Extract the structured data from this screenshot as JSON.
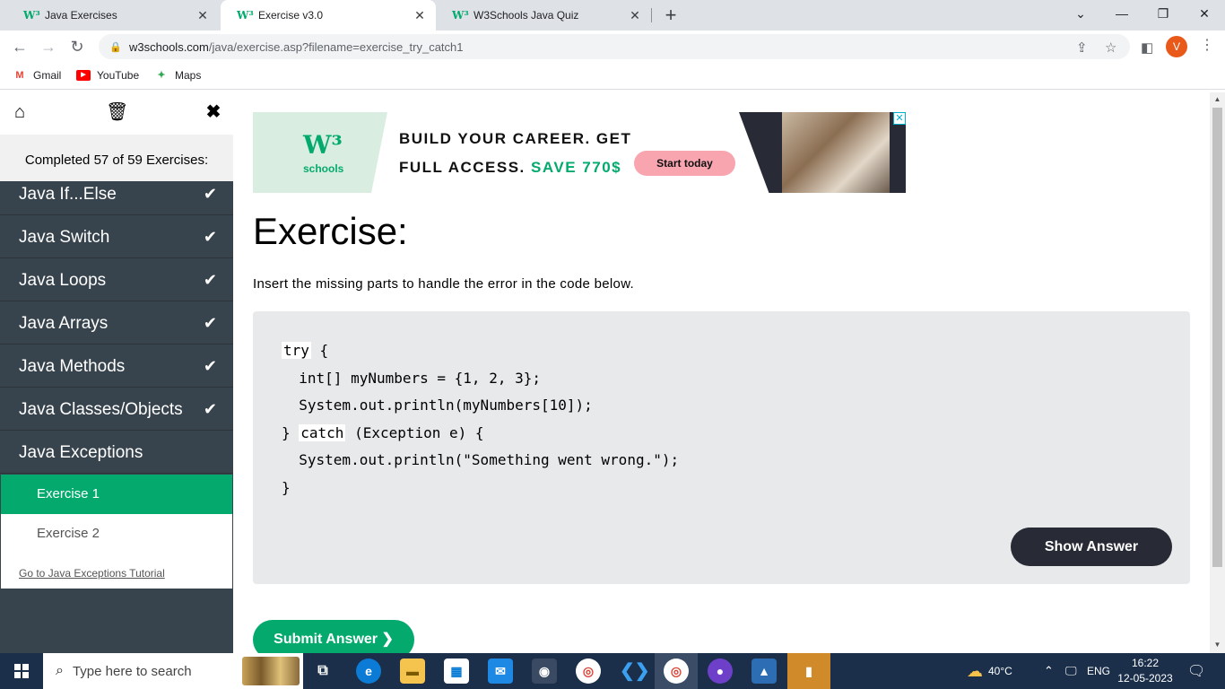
{
  "browser": {
    "tabs": [
      {
        "title": "Java Exercises",
        "favicon": "W³",
        "active": false
      },
      {
        "title": "Exercise v3.0",
        "favicon": "W³",
        "active": true
      },
      {
        "title": "W3Schools Java Quiz",
        "favicon": "W³",
        "active": false
      }
    ],
    "new_tab": "+",
    "window_controls": {
      "dropdown": "⌄",
      "minimize": "—",
      "restore": "❐",
      "close": "✕"
    },
    "url_host": "w3schools.com",
    "url_path": "/java/exercise.asp?filename=exercise_try_catch1",
    "profile_initial": "V",
    "bookmarks": [
      {
        "label": "Gmail",
        "icon": "gmail-icon"
      },
      {
        "label": "YouTube",
        "icon": "youtube-icon"
      },
      {
        "label": "Maps",
        "icon": "maps-icon"
      }
    ]
  },
  "sidebar": {
    "completed_text": "Completed 57 of 59 Exercises:",
    "items": [
      {
        "label": "Java If...Else",
        "done": true
      },
      {
        "label": "Java Switch",
        "done": true
      },
      {
        "label": "Java Loops",
        "done": true
      },
      {
        "label": "Java Arrays",
        "done": true
      },
      {
        "label": "Java Methods",
        "done": true
      },
      {
        "label": "Java Classes/Objects",
        "done": true
      },
      {
        "label": "Java Exceptions",
        "done": false
      }
    ],
    "exercises": [
      "Exercise 1",
      "Exercise 2"
    ],
    "tutorial_link": "Go to Java Exceptions Tutorial"
  },
  "ad": {
    "logo_mark": "W³",
    "logo_text": "schools",
    "line1": "BUILD YOUR CAREER. GET",
    "line2_a": "FULL ACCESS.",
    "line2_b": "SAVE 770$",
    "button": "Start today",
    "close": "✕"
  },
  "exercise": {
    "title": "Exercise:",
    "description": "Insert the missing parts to handle the error in the code below.",
    "code": {
      "l1_kw": "try",
      "l1_rest": " {",
      "l2": "  int[] myNumbers = {1, 2, 3};",
      "l3": "  System.out.println(myNumbers[10]);",
      "l4_pre": "} ",
      "l4_kw": "catch",
      "l4_rest": " (Exception e) {",
      "l5": "  System.out.println(\"Something went wrong.\");",
      "l6": "}"
    },
    "show_answer": "Show Answer",
    "submit": "Submit Answer ❯"
  },
  "taskbar": {
    "search_placeholder": "Type here to search",
    "weather": "40°C",
    "language": "ENG",
    "time": "16:22",
    "date": "12-05-2023"
  },
  "colors": {
    "accent_green": "#04aa6d",
    "sidebar_bg": "#38444d",
    "code_bg": "#e7e9eb",
    "dark_button": "#282a35"
  }
}
